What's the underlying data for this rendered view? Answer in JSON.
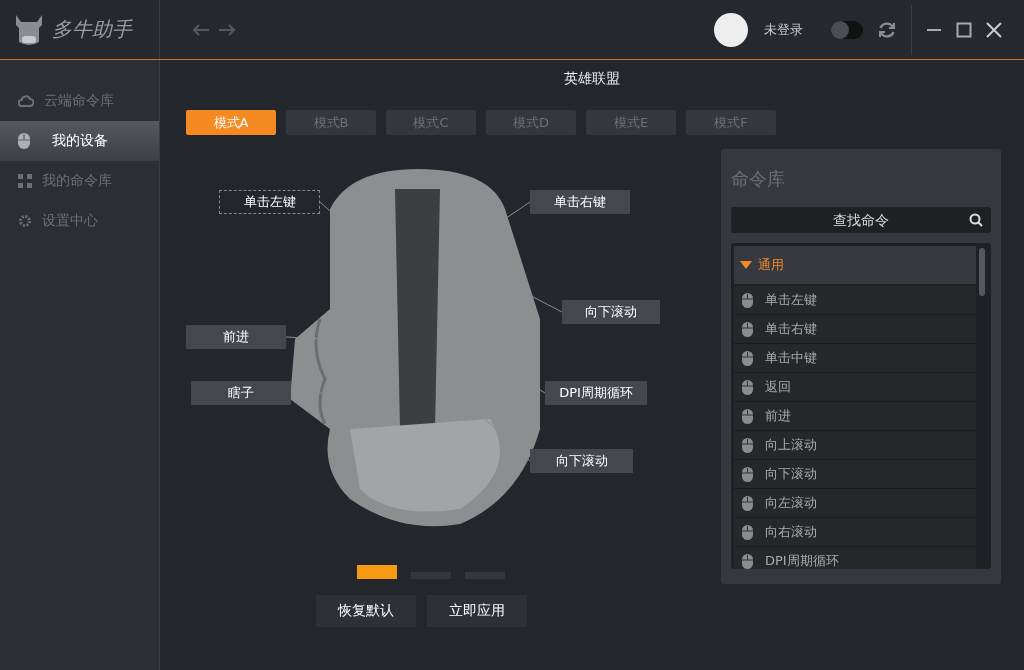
{
  "app": {
    "name": "多牛助手"
  },
  "user": {
    "status": "未登录",
    "toggle_on": false
  },
  "sidebar": {
    "items": [
      {
        "label": "云端命令库",
        "selected": false
      },
      {
        "label": "我的设备",
        "selected": true
      },
      {
        "label": "我的命令库",
        "selected": false
      },
      {
        "label": "设置中心",
        "selected": false
      }
    ]
  },
  "page_title": "英雄联盟",
  "tabs": [
    {
      "label": "模式A",
      "selected": true
    },
    {
      "label": "模式B",
      "selected": false
    },
    {
      "label": "模式C",
      "selected": false
    },
    {
      "label": "模式D",
      "selected": false
    },
    {
      "label": "模式E",
      "selected": false
    },
    {
      "label": "模式F",
      "selected": false
    }
  ],
  "callouts": [
    {
      "label": "单击左键",
      "selected": true
    },
    {
      "label": "单击右键",
      "selected": false
    },
    {
      "label": "向下滚动",
      "selected": false
    },
    {
      "label": "前进",
      "selected": false
    },
    {
      "label": "瞎子",
      "selected": false
    },
    {
      "label": "DPI周期循环",
      "selected": false
    },
    {
      "label": "向下滚动",
      "selected": false
    }
  ],
  "pager": [
    {
      "selected": true
    },
    {
      "selected": false
    },
    {
      "selected": false
    }
  ],
  "buttons": [
    "恢复默认",
    "立即应用"
  ],
  "library": {
    "title": "命令库",
    "search": {
      "placeholder": "查找命令"
    },
    "group": {
      "label": "通用",
      "expanded": true
    },
    "items": [
      "单击左键",
      "单击右键",
      "单击中键",
      "返回",
      "前进",
      "向上滚动",
      "向下滚动",
      "向左滚动",
      "向右滚动",
      "DPI周期循环"
    ]
  }
}
